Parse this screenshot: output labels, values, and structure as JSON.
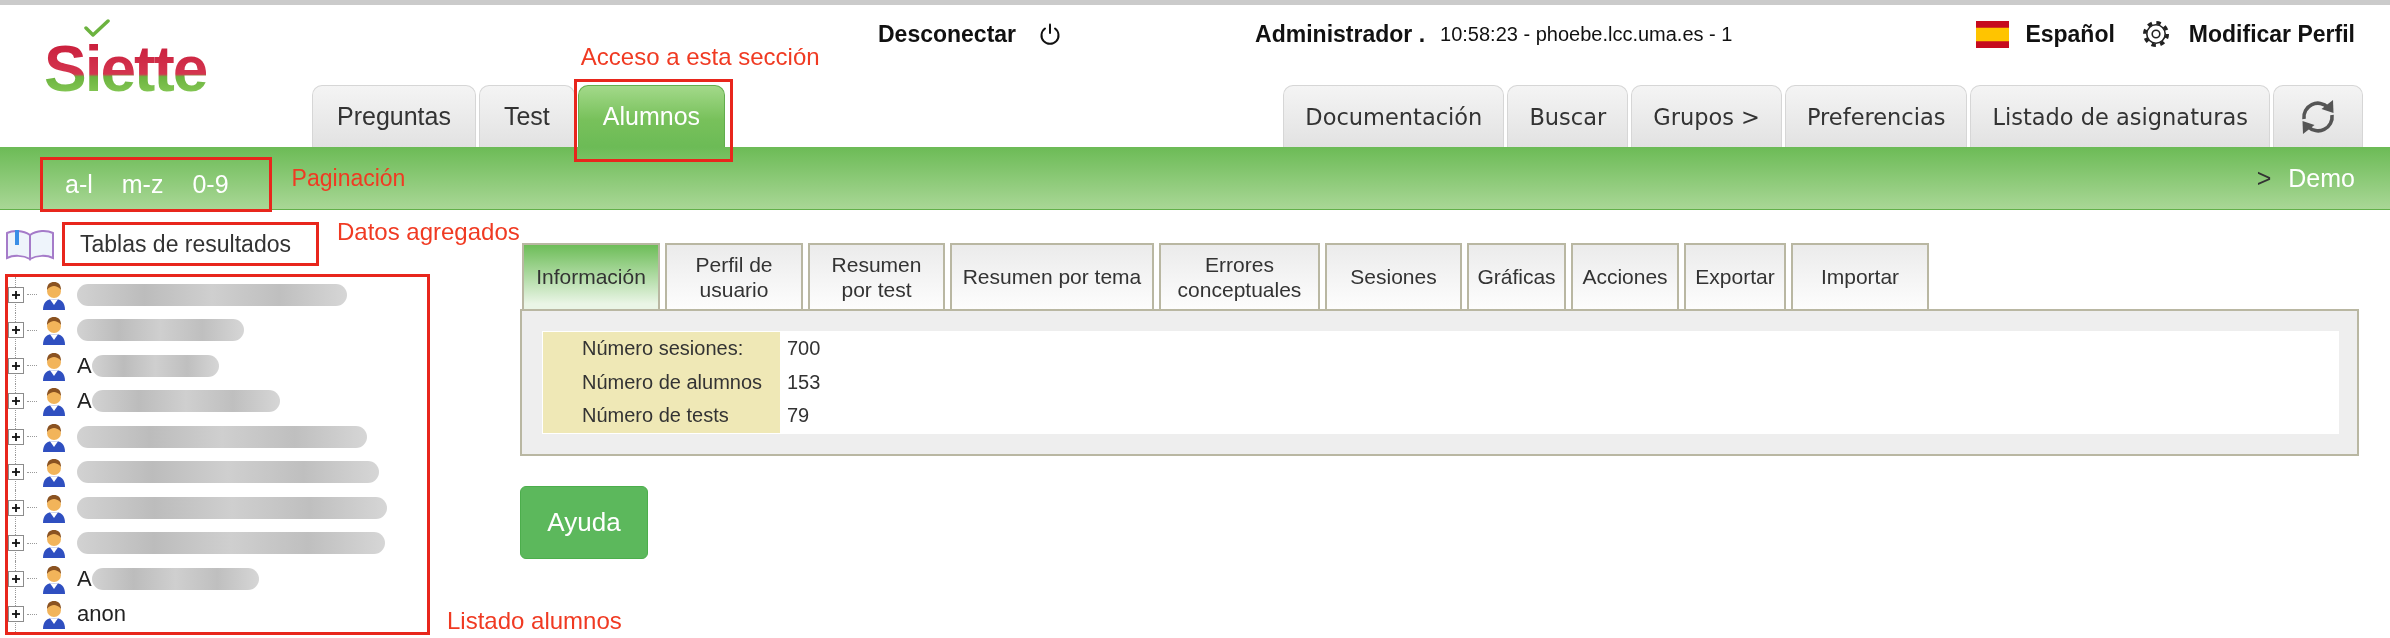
{
  "header": {
    "logo": "Siette",
    "logout": "Desconectar",
    "user": "Administrador .",
    "session_info": "10:58:23 - phoebe.lcc.uma.es - 1",
    "language": "Español",
    "profile": "Modificar Perfil"
  },
  "main_tabs": [
    {
      "label": "Preguntas",
      "selected": false,
      "highlighted": false
    },
    {
      "label": "Test",
      "selected": false,
      "highlighted": false
    },
    {
      "label": "Alumnos",
      "selected": true,
      "highlighted": true,
      "callout": "Acceso a esta sección"
    }
  ],
  "right_tabs": [
    {
      "kind": "text",
      "label": "Documentación"
    },
    {
      "kind": "text",
      "label": "Buscar"
    },
    {
      "kind": "text",
      "label": "Grupos >"
    },
    {
      "kind": "text",
      "label": "Preferencias"
    },
    {
      "kind": "text",
      "label": "Listado de asignaturas"
    },
    {
      "kind": "icon"
    }
  ],
  "nav_bar": {
    "pagination": {
      "links": [
        "a-l",
        "m-z",
        "0-9"
      ],
      "highlighted": true,
      "callout": "Paginación"
    },
    "breadcrumb": {
      "separator": ">",
      "current": "Demo"
    }
  },
  "results_tables": {
    "label": "Tablas de resultados",
    "highlighted": true,
    "callout": "Datos agregados"
  },
  "students": {
    "highlighted": true,
    "callout": "Listado alumnos",
    "items": [
      {
        "expanded": false,
        "redacted": true
      },
      {
        "expanded": false,
        "redacted": true
      },
      {
        "name": "A",
        "expanded": false,
        "redacted": true
      },
      {
        "name": "A",
        "expanded": false,
        "redacted": true
      },
      {
        "expanded": false,
        "redacted": true
      },
      {
        "expanded": false,
        "redacted": true
      },
      {
        "expanded": false,
        "redacted": true
      },
      {
        "expanded": false,
        "redacted": true
      },
      {
        "name": "A",
        "expanded": false,
        "redacted": true
      },
      {
        "name": "anon",
        "expanded": false,
        "redacted": false
      }
    ]
  },
  "subtabs": [
    {
      "label": "Información",
      "selected": true
    },
    {
      "label": "Perfil de usuario",
      "selected": false
    },
    {
      "label": "Resumen por test",
      "selected": false
    },
    {
      "label": "Resumen por tema",
      "selected": false
    },
    {
      "label": "Errores conceptuales",
      "selected": false
    },
    {
      "label": "Sesiones",
      "selected": false
    },
    {
      "label": "Gráficas",
      "selected": false
    },
    {
      "label": "Acciones",
      "selected": false
    },
    {
      "label": "Exportar",
      "selected": false
    },
    {
      "label": "Importar",
      "selected": false
    }
  ],
  "info_rows": [
    {
      "label": "Número sesiones:",
      "value": "700"
    },
    {
      "label": "Número de alumnos",
      "value": "153"
    },
    {
      "label": "Número de tests",
      "value": "79"
    }
  ],
  "help_button": "Ayuda"
}
